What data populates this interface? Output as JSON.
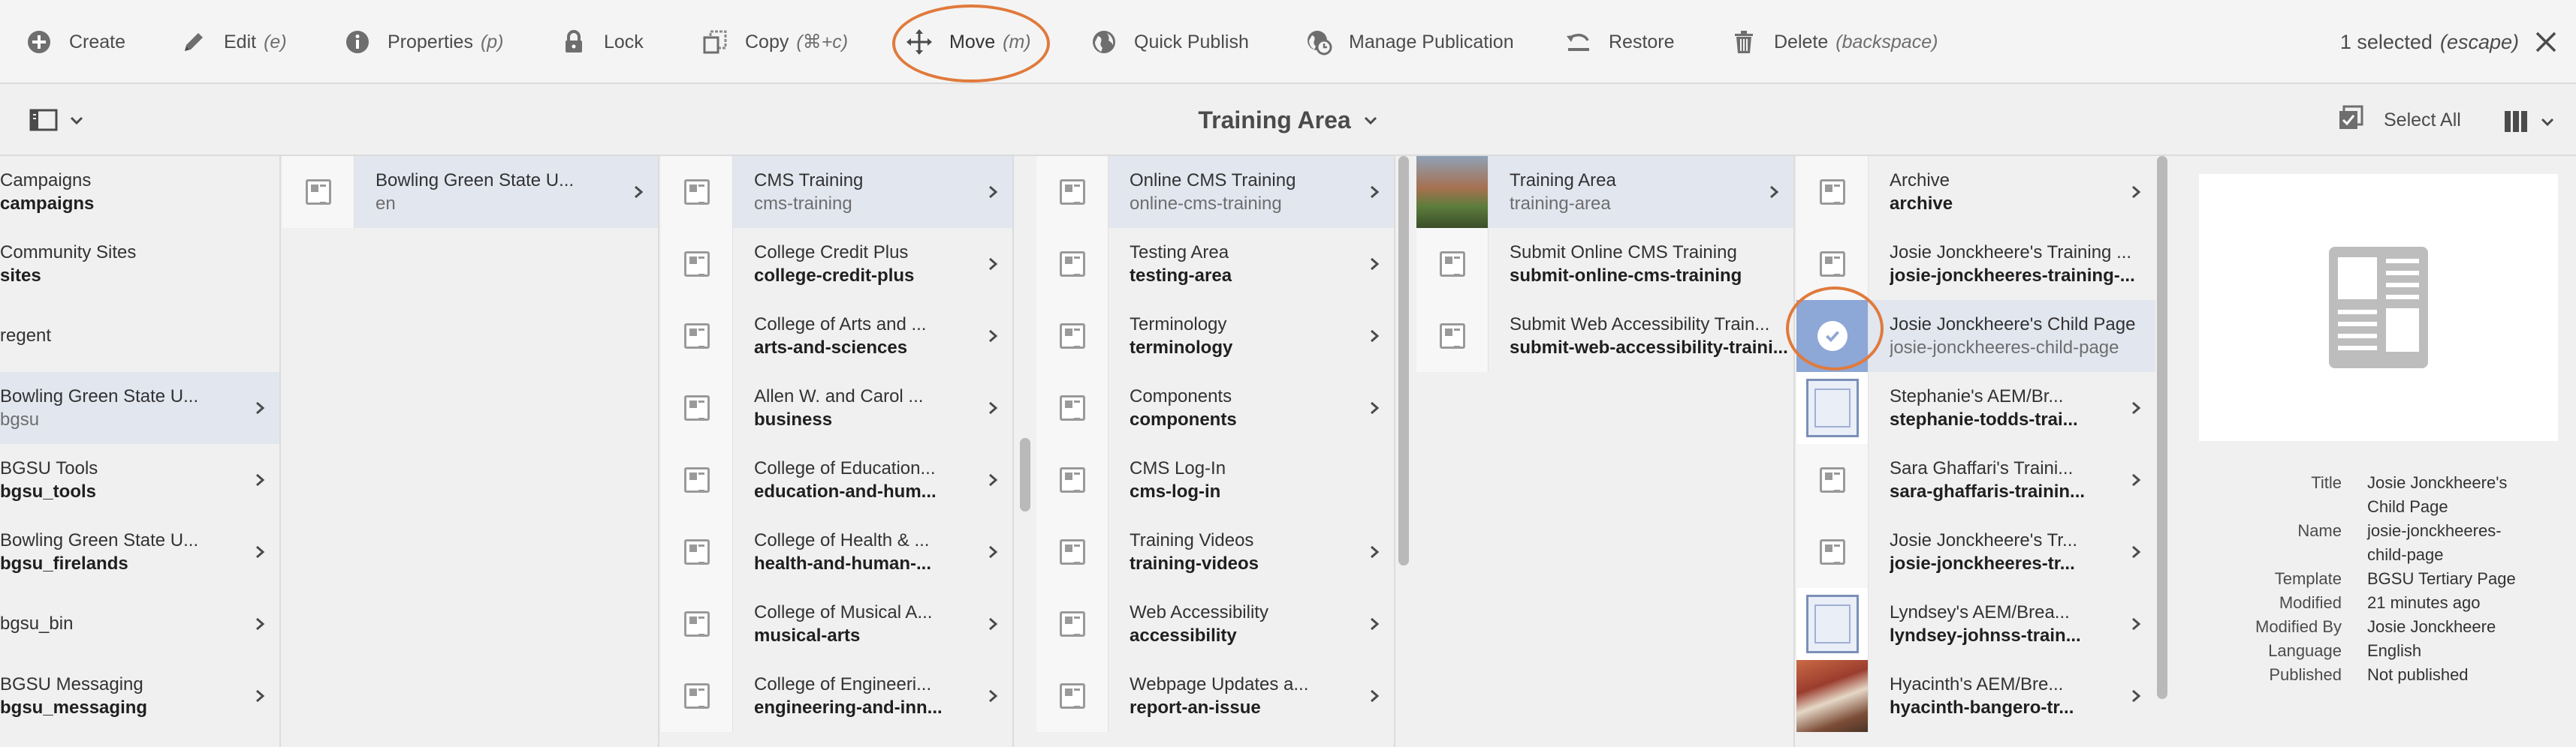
{
  "actionbar": {
    "create": "Create",
    "edit": "Edit",
    "edit_kb": "(e)",
    "properties": "Properties",
    "properties_kb": "(p)",
    "lock": "Lock",
    "copy": "Copy",
    "copy_kb": "(⌘+c)",
    "move": "Move",
    "move_kb": "(m)",
    "quick_publish": "Quick Publish",
    "manage_publication": "Manage Publication",
    "restore": "Restore",
    "delete": "Delete",
    "delete_kb": "(backspace)",
    "selected": "1 selected",
    "selected_kb": "(escape)"
  },
  "titlebar": {
    "title": "Training Area",
    "select_all": "Select All"
  },
  "columns": [
    {
      "items": [
        {
          "name": "Campaigns",
          "slug": "campaigns",
          "chevron": false,
          "active": false
        },
        {
          "name": "Community Sites",
          "slug": "sites",
          "chevron": false,
          "active": false
        },
        {
          "name": "regent",
          "slug": "",
          "chevron": false,
          "active": false
        },
        {
          "name": "Bowling Green State U...",
          "slug": "bgsu",
          "chevron": true,
          "active": true
        },
        {
          "name": "BGSU Tools",
          "slug": "bgsu_tools",
          "chevron": true,
          "active": false
        },
        {
          "name": "Bowling Green State U...",
          "slug": "bgsu_firelands",
          "chevron": true,
          "active": false
        },
        {
          "name": "bgsu_bin",
          "slug": "",
          "chevron": true,
          "active": false
        },
        {
          "name": "BGSU Messaging",
          "slug": "bgsu_messaging",
          "chevron": true,
          "active": false
        }
      ]
    },
    {
      "items": [
        {
          "name": "Bowling Green State U...",
          "slug": "en",
          "chevron": true,
          "active": true
        }
      ]
    },
    {
      "items": [
        {
          "name": "CMS Training",
          "slug": "cms-training",
          "chevron": true,
          "active": true
        },
        {
          "name": "College Credit Plus",
          "slug": "college-credit-plus",
          "chevron": true,
          "active": false
        },
        {
          "name": "College of Arts and ...",
          "slug": "arts-and-sciences",
          "chevron": true,
          "active": false
        },
        {
          "name": "Allen W. and Carol ...",
          "slug": "business",
          "chevron": true,
          "active": false
        },
        {
          "name": "College of Education...",
          "slug": "education-and-hum...",
          "chevron": true,
          "active": false
        },
        {
          "name": "College of Health & ...",
          "slug": "health-and-human-...",
          "chevron": true,
          "active": false
        },
        {
          "name": "College of Musical A...",
          "slug": "musical-arts",
          "chevron": true,
          "active": false
        },
        {
          "name": "College of Engineeri...",
          "slug": "engineering-and-inn...",
          "chevron": true,
          "active": false
        }
      ]
    },
    {
      "items": [
        {
          "name": "Online CMS Training",
          "slug": "online-cms-training",
          "chevron": true,
          "active": true
        },
        {
          "name": "Testing Area",
          "slug": "testing-area",
          "chevron": true,
          "active": false
        },
        {
          "name": "Terminology",
          "slug": "terminology",
          "chevron": true,
          "active": false
        },
        {
          "name": "Components",
          "slug": "components",
          "chevron": true,
          "active": false
        },
        {
          "name": "CMS Log-In",
          "slug": "cms-log-in",
          "chevron": false,
          "active": false
        },
        {
          "name": "Training Videos",
          "slug": "training-videos",
          "chevron": true,
          "active": false
        },
        {
          "name": "Web Accessibility",
          "slug": "accessibility",
          "chevron": true,
          "active": false
        },
        {
          "name": "Webpage Updates a...",
          "slug": "report-an-issue",
          "chevron": true,
          "active": false
        }
      ]
    },
    {
      "items": [
        {
          "name": "Training Area",
          "slug": "training-area",
          "chevron": true,
          "active": true
        },
        {
          "name": "Submit Online CMS Training",
          "slug": "submit-online-cms-training",
          "chevron": false,
          "active": false
        },
        {
          "name": "Submit Web Accessibility Train...",
          "slug": "submit-web-accessibility-traini...",
          "chevron": false,
          "active": false
        }
      ]
    },
    {
      "items": [
        {
          "name": "Archive",
          "slug": "archive",
          "chevron": true,
          "active": false
        },
        {
          "name": "Josie Jonckheere's Training ...",
          "slug": "josie-jonckheeres-training-...",
          "chevron": false,
          "active": false
        },
        {
          "name": "Josie Jonckheere's Child Page",
          "slug": "josie-jonckheeres-child-page",
          "chevron": false,
          "active": true
        },
        {
          "name": "Stephanie's AEM/Br...",
          "slug": "stephanie-todds-trai...",
          "chevron": true,
          "active": false
        },
        {
          "name": "Sara Ghaffari's Traini...",
          "slug": "sara-ghaffaris-trainin...",
          "chevron": true,
          "active": false
        },
        {
          "name": "Josie Jonckheere's Tr...",
          "slug": "josie-jonckheeres-tr...",
          "chevron": true,
          "active": false
        },
        {
          "name": "Lyndsey's AEM/Brea...",
          "slug": "lyndsey-johnss-train...",
          "chevron": true,
          "active": false
        },
        {
          "name": "Hyacinth's AEM/Bre...",
          "slug": "hyacinth-bangero-tr...",
          "chevron": true,
          "active": false
        }
      ]
    }
  ],
  "preview": {
    "meta": [
      {
        "key": "Title",
        "value": "Josie Jonckheere's Child Page"
      },
      {
        "key": "Name",
        "value": "josie-jonckheeres-child-page"
      },
      {
        "key": "Template",
        "value": "BGSU Tertiary Page"
      },
      {
        "key": "Modified",
        "value": "21 minutes ago"
      },
      {
        "key": "Modified By",
        "value": "Josie Jonckheere"
      },
      {
        "key": "Language",
        "value": "English"
      },
      {
        "key": "Published",
        "value": "Not published"
      }
    ]
  },
  "colors": {
    "accent_circle": "#e07a3c",
    "active_row": "#e2e6ef",
    "selected_thumb": "#8da7d6"
  },
  "icons": {
    "create": "plus-circle-icon",
    "edit": "pencil-icon",
    "properties": "info-icon",
    "lock": "lock-icon",
    "copy": "copy-icon",
    "move": "move-arrows-icon",
    "quick_publish": "globe-icon",
    "manage_publication": "globe-clock-icon",
    "restore": "restore-icon",
    "delete": "trash-icon",
    "close": "close-icon"
  }
}
